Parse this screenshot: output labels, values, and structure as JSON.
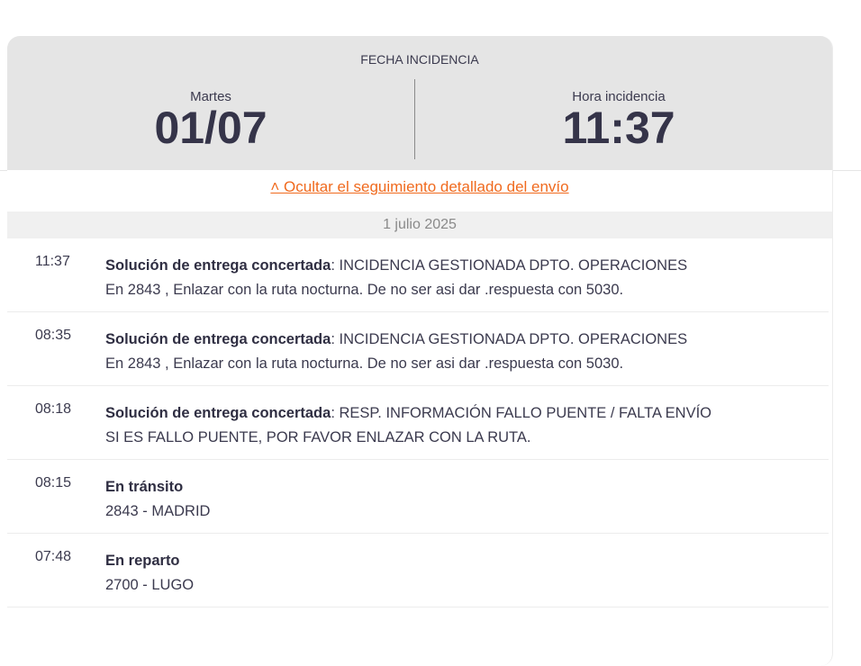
{
  "header": {
    "title": "FECHA INCIDENCIA",
    "day_label": "Martes",
    "date": "01/07",
    "time_label": "Hora incidencia",
    "time": "11:37"
  },
  "toggle_link": "˄ Ocultar el seguimiento detallado del envío",
  "date_group": "1 julio 2025",
  "events": [
    {
      "time": "11:37",
      "status": "Solución de entrega concertada",
      "detail": ": INCIDENCIA GESTIONADA DPTO. OPERACIONES",
      "line2": "En 2843 , Enlazar con la ruta nocturna. De no ser asi dar .respuesta con 5030."
    },
    {
      "time": "08:35",
      "status": "Solución de entrega concertada",
      "detail": ": INCIDENCIA GESTIONADA DPTO. OPERACIONES",
      "line2": "En 2843 , Enlazar con la ruta nocturna. De no ser asi dar .respuesta con 5030."
    },
    {
      "time": "08:18",
      "status": "Solución de entrega concertada",
      "detail": ": RESP. INFORMACIÓN FALLO PUENTE / FALTA ENVÍO",
      "line2": "SI ES FALLO PUENTE, POR FAVOR ENLAZAR CON LA RUTA."
    },
    {
      "time": "08:15",
      "status": "En tránsito",
      "detail": "",
      "line2": "2843 - MADRID"
    },
    {
      "time": "07:48",
      "status": "En reparto",
      "detail": "",
      "line2": "2700 - LUGO"
    }
  ],
  "colors": {
    "accent": "#f06a1e",
    "header_bg": "#e5e5e5",
    "text": "#3b3a4e"
  }
}
